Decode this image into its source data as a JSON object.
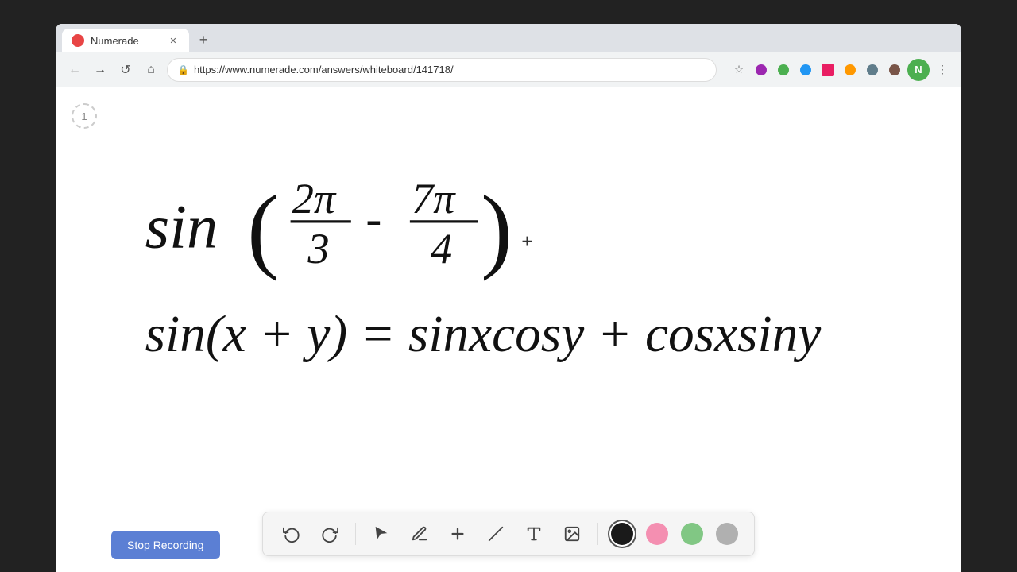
{
  "browser": {
    "tab": {
      "title": "Numerade",
      "favicon_color": "#e84545",
      "url": "https://www.numerade.com/answers/whiteboard/141718/"
    },
    "nav": {
      "back_label": "←",
      "forward_label": "→",
      "reload_label": "↺",
      "home_label": "⌂"
    }
  },
  "page_indicator": "1",
  "toolbar": {
    "undo_label": "↺",
    "redo_label": "↻",
    "select_label": "▶",
    "pen_label": "✏",
    "plus_label": "+",
    "eraser_label": "/",
    "text_label": "T",
    "image_label": "🖼",
    "colors": [
      {
        "name": "black",
        "hex": "#1a1a1a",
        "selected": true
      },
      {
        "name": "pink",
        "hex": "#f48fb1",
        "selected": false
      },
      {
        "name": "green",
        "hex": "#81c784",
        "selected": false
      },
      {
        "name": "gray",
        "hex": "#b0b0b0",
        "selected": false
      }
    ]
  },
  "stop_recording_btn": "Stop Recording",
  "cursor_symbol": "+"
}
